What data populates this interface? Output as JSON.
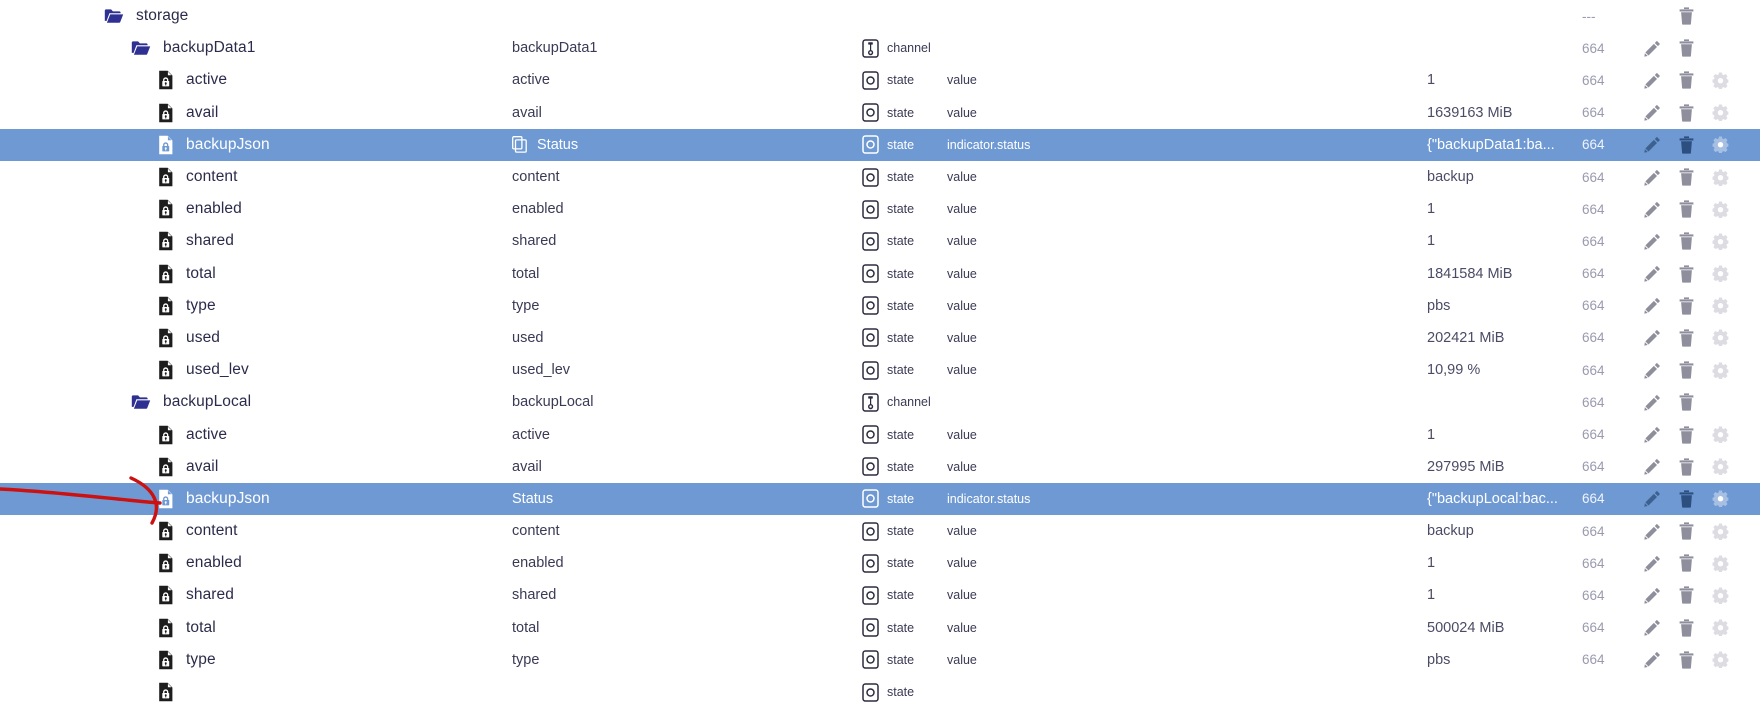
{
  "colors": {
    "selection": "#6f99d3",
    "folder_icon": "#2e3192",
    "file_icon": "#1d1d1d",
    "text": "#2b2b4b",
    "muted": "#9a9ab0",
    "annotation": "#cc1111"
  },
  "icons": {
    "folder": "folder-icon",
    "file_locked": "locked-file-icon",
    "copy": "copy-icon",
    "channel": "channel-type-icon",
    "state": "state-type-icon",
    "edit": "edit-pencil-icon",
    "delete": "delete-trash-icon",
    "settings": "settings-gear-icon"
  },
  "annotation": {
    "type": "hand-drawn-red-arrow",
    "points_to_row_index": 13
  },
  "rows": [
    {
      "name": "storage",
      "kind": "folder",
      "indent": 0,
      "alias": "",
      "copy": false,
      "type": "",
      "type_icon": "",
      "role": "",
      "value": "",
      "perm": "---",
      "actions": [
        "spacer",
        "delete"
      ],
      "selected": false
    },
    {
      "name": "backupData1",
      "kind": "folder",
      "indent": 1,
      "alias": "backupData1",
      "copy": false,
      "type": "channel",
      "type_icon": "channel",
      "role": "",
      "value": "",
      "perm": "664",
      "actions": [
        "edit",
        "delete"
      ],
      "selected": false
    },
    {
      "name": "active",
      "kind": "file",
      "indent": 2,
      "alias": "active",
      "copy": false,
      "type": "state",
      "type_icon": "state",
      "role": "value",
      "value": "1",
      "perm": "664",
      "actions": [
        "edit",
        "delete",
        "settings"
      ],
      "selected": false
    },
    {
      "name": "avail",
      "kind": "file",
      "indent": 2,
      "alias": "avail",
      "copy": false,
      "type": "state",
      "type_icon": "state",
      "role": "value",
      "value": "1639163 MiB",
      "perm": "664",
      "actions": [
        "edit",
        "delete",
        "settings"
      ],
      "selected": false
    },
    {
      "name": "backupJson",
      "kind": "file",
      "indent": 2,
      "alias": "Status",
      "copy": true,
      "type": "state",
      "type_icon": "state",
      "role": "indicator.status",
      "value": "{\"backupData1:ba...",
      "perm": "664",
      "actions": [
        "edit",
        "delete",
        "settings"
      ],
      "selected": true
    },
    {
      "name": "content",
      "kind": "file",
      "indent": 2,
      "alias": "content",
      "copy": false,
      "type": "state",
      "type_icon": "state",
      "role": "value",
      "value": "backup",
      "perm": "664",
      "actions": [
        "edit",
        "delete",
        "settings"
      ],
      "selected": false
    },
    {
      "name": "enabled",
      "kind": "file",
      "indent": 2,
      "alias": "enabled",
      "copy": false,
      "type": "state",
      "type_icon": "state",
      "role": "value",
      "value": "1",
      "perm": "664",
      "actions": [
        "edit",
        "delete",
        "settings"
      ],
      "selected": false
    },
    {
      "name": "shared",
      "kind": "file",
      "indent": 2,
      "alias": "shared",
      "copy": false,
      "type": "state",
      "type_icon": "state",
      "role": "value",
      "value": "1",
      "perm": "664",
      "actions": [
        "edit",
        "delete",
        "settings"
      ],
      "selected": false
    },
    {
      "name": "total",
      "kind": "file",
      "indent": 2,
      "alias": "total",
      "copy": false,
      "type": "state",
      "type_icon": "state",
      "role": "value",
      "value": "1841584 MiB",
      "perm": "664",
      "actions": [
        "edit",
        "delete",
        "settings"
      ],
      "selected": false
    },
    {
      "name": "type",
      "kind": "file",
      "indent": 2,
      "alias": "type",
      "copy": false,
      "type": "state",
      "type_icon": "state",
      "role": "value",
      "value": "pbs",
      "perm": "664",
      "actions": [
        "edit",
        "delete",
        "settings"
      ],
      "selected": false
    },
    {
      "name": "used",
      "kind": "file",
      "indent": 2,
      "alias": "used",
      "copy": false,
      "type": "state",
      "type_icon": "state",
      "role": "value",
      "value": "202421 MiB",
      "perm": "664",
      "actions": [
        "edit",
        "delete",
        "settings"
      ],
      "selected": false
    },
    {
      "name": "used_lev",
      "kind": "file",
      "indent": 2,
      "alias": "used_lev",
      "copy": false,
      "type": "state",
      "type_icon": "state",
      "role": "value",
      "value": "10,99 %",
      "perm": "664",
      "actions": [
        "edit",
        "delete",
        "settings"
      ],
      "selected": false
    },
    {
      "name": "backupLocal",
      "kind": "folder",
      "indent": 1,
      "alias": "backupLocal",
      "copy": false,
      "type": "channel",
      "type_icon": "channel",
      "role": "",
      "value": "",
      "perm": "664",
      "actions": [
        "edit",
        "delete"
      ],
      "selected": false
    },
    {
      "name": "active",
      "kind": "file",
      "indent": 2,
      "alias": "active",
      "copy": false,
      "type": "state",
      "type_icon": "state",
      "role": "value",
      "value": "1",
      "perm": "664",
      "actions": [
        "edit",
        "delete",
        "settings"
      ],
      "selected": false
    },
    {
      "name": "avail",
      "kind": "file",
      "indent": 2,
      "alias": "avail",
      "copy": false,
      "type": "state",
      "type_icon": "state",
      "role": "value",
      "value": "297995 MiB",
      "perm": "664",
      "actions": [
        "edit",
        "delete",
        "settings"
      ],
      "selected": false
    },
    {
      "name": "backupJson",
      "kind": "file",
      "indent": 2,
      "alias": "Status",
      "copy": false,
      "type": "state",
      "type_icon": "state",
      "role": "indicator.status",
      "value": "{\"backupLocal:bac...",
      "perm": "664",
      "actions": [
        "edit",
        "delete",
        "settings"
      ],
      "selected": true
    },
    {
      "name": "content",
      "kind": "file",
      "indent": 2,
      "alias": "content",
      "copy": false,
      "type": "state",
      "type_icon": "state",
      "role": "value",
      "value": "backup",
      "perm": "664",
      "actions": [
        "edit",
        "delete",
        "settings"
      ],
      "selected": false
    },
    {
      "name": "enabled",
      "kind": "file",
      "indent": 2,
      "alias": "enabled",
      "copy": false,
      "type": "state",
      "type_icon": "state",
      "role": "value",
      "value": "1",
      "perm": "664",
      "actions": [
        "edit",
        "delete",
        "settings"
      ],
      "selected": false
    },
    {
      "name": "shared",
      "kind": "file",
      "indent": 2,
      "alias": "shared",
      "copy": false,
      "type": "state",
      "type_icon": "state",
      "role": "value",
      "value": "1",
      "perm": "664",
      "actions": [
        "edit",
        "delete",
        "settings"
      ],
      "selected": false
    },
    {
      "name": "total",
      "kind": "file",
      "indent": 2,
      "alias": "total",
      "copy": false,
      "type": "state",
      "type_icon": "state",
      "role": "value",
      "value": "500024 MiB",
      "perm": "664",
      "actions": [
        "edit",
        "delete",
        "settings"
      ],
      "selected": false
    },
    {
      "name": "type",
      "kind": "file",
      "indent": 2,
      "alias": "type",
      "copy": false,
      "type": "state",
      "type_icon": "state",
      "role": "value",
      "value": "pbs",
      "perm": "664",
      "actions": [
        "edit",
        "delete",
        "settings"
      ],
      "selected": false
    },
    {
      "name": "",
      "kind": "file",
      "indent": 2,
      "alias": "",
      "copy": false,
      "type": "state",
      "type_icon": "state",
      "role": "",
      "value": "",
      "perm": "",
      "actions": [],
      "selected": false
    }
  ]
}
